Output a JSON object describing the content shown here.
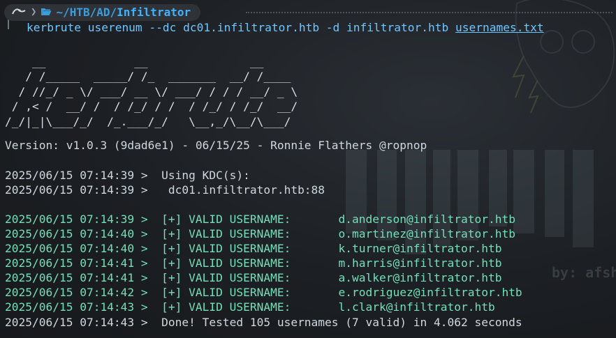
{
  "prompt": {
    "path_prefix": "~/HTB/AD/",
    "path_last": "Infiltrator"
  },
  "command": {
    "text": "kerbrute userenum --dc dc01.infiltrator.htb -d infiltrator.htb ",
    "arg_file": "usernames.txt"
  },
  "banner_art": [
    "    __             __               __     ",
    "   / /_____  _____/ /_  _______  __/ /____ ",
    "  / //_/ _ \\/ ___/ __ \\/ ___/ / / / __/ _ \\",
    " / ,< /  __/ /  / /_/ / /  / /_/ / /_/  __/",
    "/_/|_|\\___/_/  /_.___/_/   \\__,_/\\__/\\___/ "
  ],
  "version_line": "Version: v1.0.3 (9dad6e1) - 06/15/25 - Ronnie Flathers @ropnop",
  "kdc_lines": [
    "2025/06/15 07:14:39 >  Using KDC(s):",
    "2025/06/15 07:14:39 >   dc01.infiltrator.htb:88"
  ],
  "valid_users": [
    {
      "ts": "2025/06/15 07:14:39 >  ",
      "label": "[+] VALID USERNAME:       ",
      "user": "d.anderson@infiltrator.htb"
    },
    {
      "ts": "2025/06/15 07:14:40 >  ",
      "label": "[+] VALID USERNAME:       ",
      "user": "o.martinez@infiltrator.htb"
    },
    {
      "ts": "2025/06/15 07:14:40 >  ",
      "label": "[+] VALID USERNAME:       ",
      "user": "k.turner@infiltrator.htb"
    },
    {
      "ts": "2025/06/15 07:14:41 >  ",
      "label": "[+] VALID USERNAME:       ",
      "user": "m.harris@infiltrator.htb"
    },
    {
      "ts": "2025/06/15 07:14:41 >  ",
      "label": "[+] VALID USERNAME:       ",
      "user": "a.walker@infiltrator.htb"
    },
    {
      "ts": "2025/06/15 07:14:42 >  ",
      "label": "[+] VALID USERNAME:       ",
      "user": "e.rodriguez@infiltrator.htb"
    },
    {
      "ts": "2025/06/15 07:14:43 >  ",
      "label": "[+] VALID USERNAME:       ",
      "user": "l.clark@infiltrator.htb"
    }
  ],
  "done_line": "2025/06/15 07:14:43 >  Done! Tested 105 usernames (7 valid) in 4.062 seconds",
  "wallpaper_text": "by: afsh",
  "colors": {
    "path": "#3a9ddc",
    "command": "#6ec6ff",
    "valid": "#73e0b9",
    "text": "#cfd8df"
  },
  "icons": {
    "os": "arch-linux-icon",
    "folder": "folder-open-icon"
  }
}
